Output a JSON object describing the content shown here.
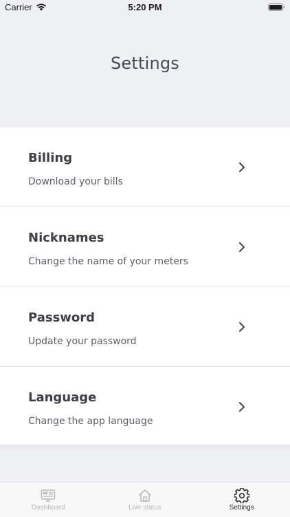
{
  "status_bar": {
    "carrier": "Carrier",
    "time": "5:20 PM"
  },
  "header": {
    "title": "Settings"
  },
  "settings": {
    "items": [
      {
        "title": "Billing",
        "subtitle": "Download your bills",
        "icon": "chevron-right-icon"
      },
      {
        "title": "Nicknames",
        "subtitle": "Change the name of your meters",
        "icon": "chevron-right-icon"
      },
      {
        "title": "Password",
        "subtitle": "Update your password",
        "icon": "chevron-right-icon"
      },
      {
        "title": "Language",
        "subtitle": "Change the app language",
        "icon": "chevron-right-icon"
      }
    ]
  },
  "tab_bar": {
    "tabs": [
      {
        "label": "Dashboard",
        "icon": "dashboard-icon",
        "active": false
      },
      {
        "label": "Live status",
        "icon": "home-icon",
        "active": false
      },
      {
        "label": "Settings",
        "icon": "gear-icon",
        "active": true
      }
    ]
  },
  "colors": {
    "background": "#eff0f4",
    "card": "#ffffff",
    "title_text": "#3d4049",
    "subtitle_text": "#5c5f68",
    "tab_inactive": "#b8b9be",
    "tab_active": "#2c2d31"
  }
}
